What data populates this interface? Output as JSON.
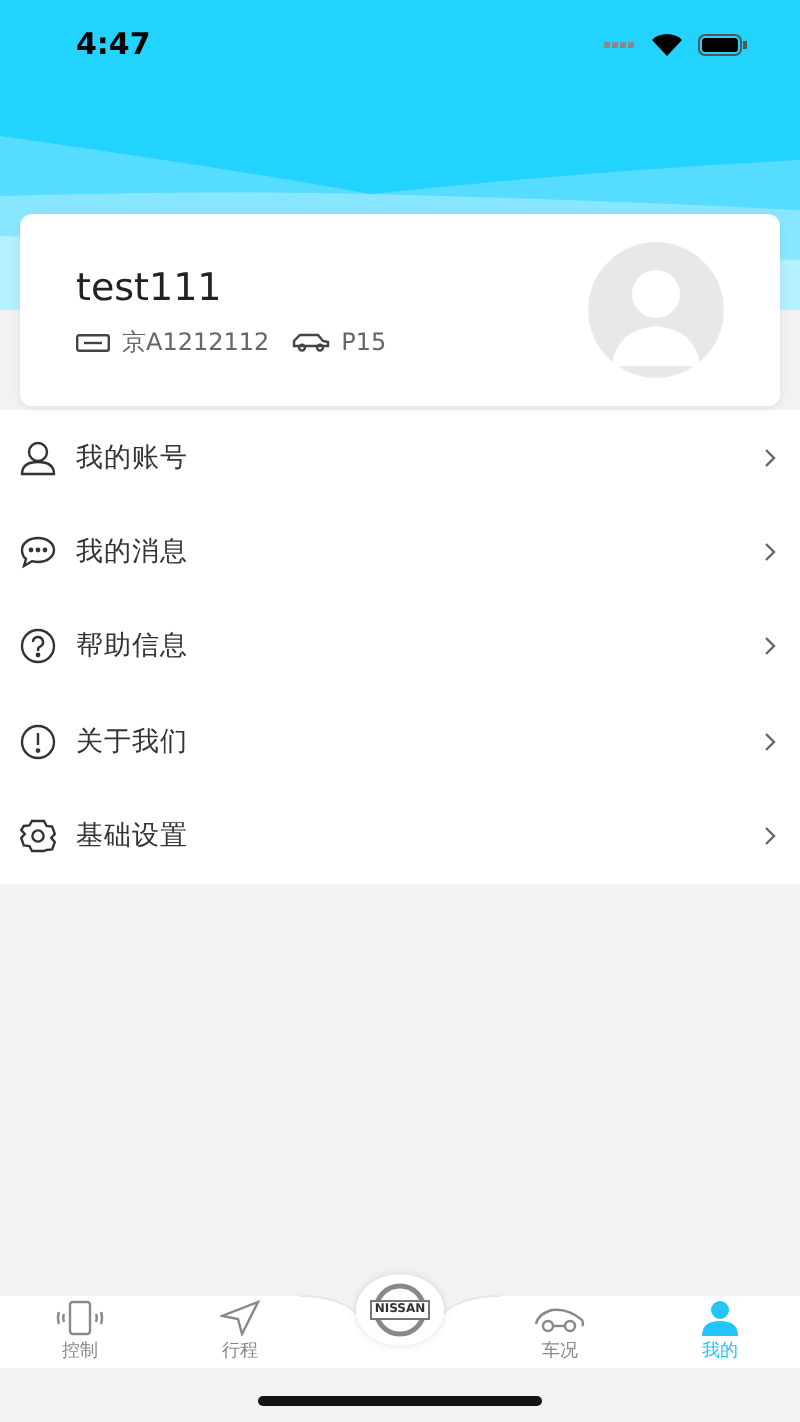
{
  "status_bar": {
    "time": "4:47"
  },
  "profile": {
    "username": "test111",
    "plate": "京A1212112",
    "model": "P15"
  },
  "menu": [
    {
      "kind": "account",
      "label": "我的账号"
    },
    {
      "kind": "messages",
      "label": "我的消息"
    },
    {
      "kind": "help",
      "label": "帮助信息"
    },
    {
      "kind": "about",
      "label": "关于我们"
    },
    {
      "kind": "settings",
      "label": "基础设置"
    }
  ],
  "tab_bar": {
    "center_logo": "NISSAN",
    "tabs": [
      {
        "kind": "control",
        "label": "控制",
        "selected": false
      },
      {
        "kind": "trip",
        "label": "行程",
        "selected": false
      },
      {
        "kind": "car",
        "label": "车况",
        "selected": false
      },
      {
        "kind": "me",
        "label": "我的",
        "selected": true
      }
    ]
  }
}
